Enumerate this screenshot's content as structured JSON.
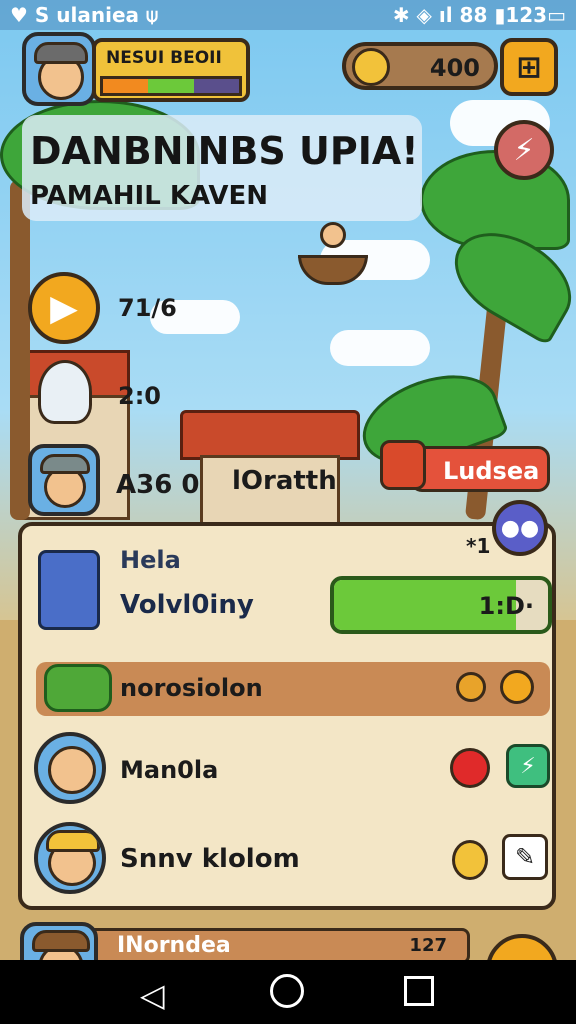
{
  "status_bar": {
    "left": "♥ S ulaniea  ⍦",
    "right": "✱ ◈ ıl 88 ▮123▭"
  },
  "player": {
    "name": "NESUI BEOII"
  },
  "currency": {
    "value": "400"
  },
  "banner": {
    "title": "DANBNINBS UPIA!",
    "subtitle": "PAMAHIL KAVEN"
  },
  "stats": [
    {
      "value": "71/6"
    },
    {
      "value": "2:0"
    },
    {
      "value": "A36  0"
    }
  ],
  "village_label": "lOratth",
  "lodge_button": "Ludsea",
  "panel": {
    "badge": "*1",
    "header": "Hela",
    "vote_label": "Volvl0iny",
    "progress_label": "1:D·",
    "progress_fraction": 0.85,
    "rows": [
      {
        "label": "norosiolon"
      },
      {
        "label": "Man0la"
      },
      {
        "label": "Snnv klolom"
      }
    ]
  },
  "bottom": {
    "label": "INorndea",
    "value": "127"
  },
  "colors": {
    "accent": "#f2a81f",
    "progress": "#6cc93a",
    "danger": "#e4523b"
  }
}
